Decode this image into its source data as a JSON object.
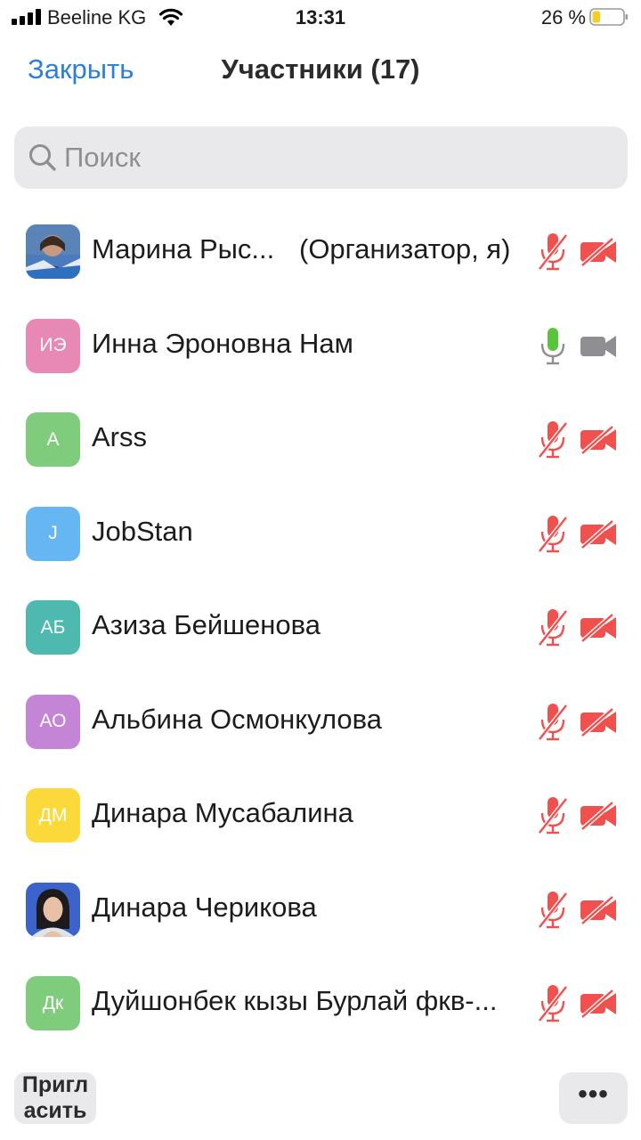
{
  "status_bar": {
    "carrier": "Beeline KG",
    "time": "13:31",
    "battery_percent": "26 %",
    "battery_level": 0.26
  },
  "header": {
    "close_label": "Закрыть",
    "title": "Участники (17)"
  },
  "search": {
    "placeholder": "Поиск"
  },
  "colors": {
    "accent": "#2f7ed8",
    "muted_red": "#f0504e",
    "mic_green": "#5ac43c",
    "cam_gray": "#8e8e93"
  },
  "participants": [
    {
      "name": "Марина Рыс...",
      "role": "(Организатор, я)",
      "initials": "",
      "avatar_color": "#3a6fb0",
      "mic": "muted",
      "video": "off"
    },
    {
      "name": "Инна Эроновна Нам",
      "initials": "ИЭ",
      "avatar_color": "#e889b5",
      "mic": "on",
      "video": "on"
    },
    {
      "name": "Arss",
      "initials": "A",
      "avatar_color": "#7fcc7c",
      "mic": "muted",
      "video": "off"
    },
    {
      "name": "JobStan",
      "initials": "J",
      "avatar_color": "#65b6f3",
      "mic": "muted",
      "video": "off"
    },
    {
      "name": "Азиза Бейшенова",
      "initials": "АБ",
      "avatar_color": "#4eb9ae",
      "mic": "muted",
      "video": "off"
    },
    {
      "name": "Альбина Осмонкулова",
      "initials": "АО",
      "avatar_color": "#c585d6",
      "mic": "muted",
      "video": "off"
    },
    {
      "name": "Динара Мусабалина",
      "initials": "ДМ",
      "avatar_color": "#fbd93a",
      "mic": "muted",
      "video": "off"
    },
    {
      "name": "Динара Черикова",
      "initials": "",
      "avatar_color": "#3b63c9",
      "mic": "muted",
      "video": "off"
    },
    {
      "name": "Дуйшонбек кызы Бурлай фкв-...",
      "initials": "Дк",
      "avatar_color": "#7fcc7c",
      "mic": "muted",
      "video": "off"
    }
  ],
  "footer": {
    "invite_label_1": "Пригл",
    "invite_label_2": "асить",
    "more_label": "•••"
  }
}
